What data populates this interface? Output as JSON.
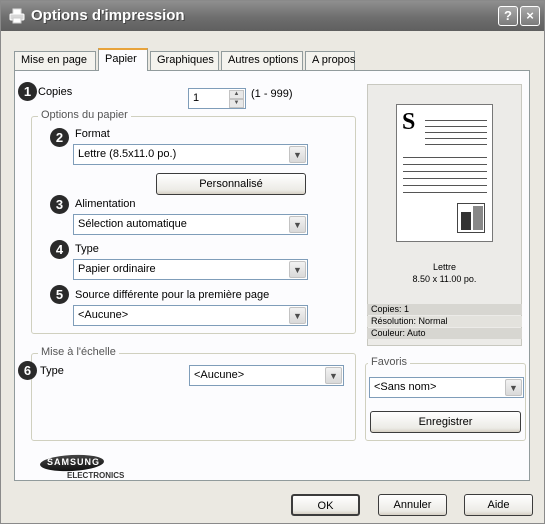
{
  "window": {
    "title": "Options d'impression",
    "help_glyph": "?",
    "close_glyph": "×"
  },
  "tabs": [
    "Mise en page",
    "Papier",
    "Graphiques",
    "Autres options",
    "A propos"
  ],
  "active_tab": "Papier",
  "markers": [
    "1",
    "2",
    "3",
    "4",
    "5",
    "6"
  ],
  "copies": {
    "label": "Copies",
    "value": "1",
    "range": "(1 - 999)"
  },
  "paper_options": {
    "group_label": "Options du papier",
    "format_label": "Format",
    "format_value": "Lettre (8.5x11.0 po.)",
    "custom_button": "Personnalisé",
    "source_label": "Alimentation",
    "source_value": "Sélection automatique",
    "type_label": "Type",
    "type_value": "Papier ordinaire",
    "first_page_label": "Source différente pour la première page",
    "first_page_value": "<Aucune>"
  },
  "scaling": {
    "group_label": "Mise à l'échelle",
    "type_label": "Type",
    "type_value": "<Aucune>"
  },
  "preview": {
    "paper_name": "Lettre",
    "paper_size": "8.50 x 11.00 po.",
    "summary": [
      "Copies: 1",
      "Résolution: Normal",
      "Couleur: Auto"
    ],
    "sheet_letter": "S"
  },
  "favorites": {
    "group_label": "Favoris",
    "value": "<Sans nom>",
    "save_button": "Enregistrer"
  },
  "brand": {
    "name": "SAMSUNG",
    "sub": "ELECTRONICS"
  },
  "buttons": {
    "ok": "OK",
    "cancel": "Annuler",
    "help": "Aide"
  },
  "colors": {
    "titlebar": "#6e6e6e",
    "accent_tab": "#e8a33a",
    "marker": "#2a2a2a"
  }
}
